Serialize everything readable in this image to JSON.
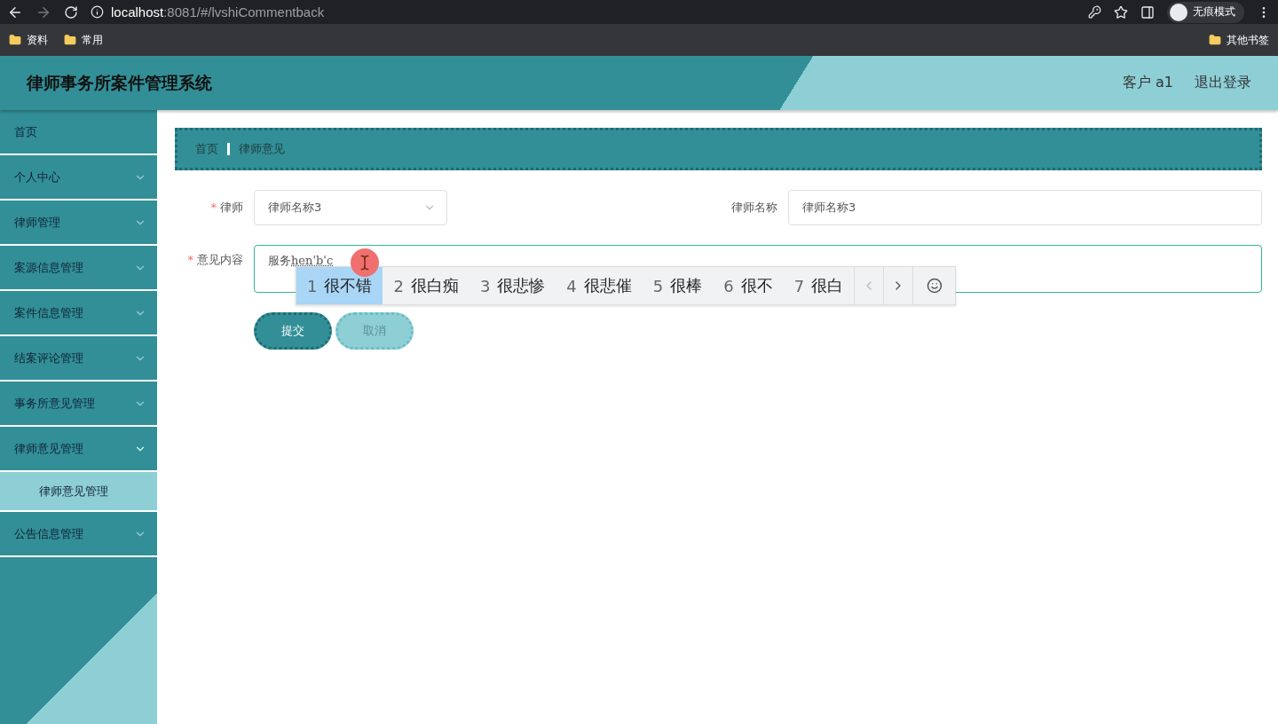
{
  "browser": {
    "url_host": "localhost",
    "url_path": ":8081/#/lvshiCommentback",
    "profile_label": "无痕模式",
    "bookmarks": [
      "资料",
      "常用"
    ],
    "other_bookmarks": "其他书签"
  },
  "header": {
    "title": "律师事务所案件管理系统",
    "user": "客户 a1",
    "logout": "退出登录"
  },
  "sidebar": {
    "items": [
      {
        "label": "首页",
        "kind": "link"
      },
      {
        "label": "个人中心",
        "kind": "menu",
        "expanded": false
      },
      {
        "label": "律师管理",
        "kind": "menu",
        "expanded": false
      },
      {
        "label": "案源信息管理",
        "kind": "menu",
        "expanded": false
      },
      {
        "label": "案件信息管理",
        "kind": "menu",
        "expanded": false
      },
      {
        "label": "结案评论管理",
        "kind": "menu",
        "expanded": false
      },
      {
        "label": "事务所意见管理",
        "kind": "menu",
        "expanded": false
      },
      {
        "label": "律师意见管理",
        "kind": "menu",
        "expanded": true,
        "children": [
          {
            "label": "律师意见管理",
            "selected": true
          }
        ]
      },
      {
        "label": "公告信息管理",
        "kind": "menu",
        "expanded": false
      }
    ]
  },
  "breadcrumb": [
    "首页",
    "律师意见"
  ],
  "form": {
    "lawyer": {
      "required_mark": "*",
      "label": "律师",
      "value": "律师名称3"
    },
    "lawyer_name": {
      "label": "律师名称",
      "value": "律师名称3"
    },
    "content": {
      "required_mark": "*",
      "label": "意见内容",
      "value": "服务",
      "composition": "hen'b'c"
    },
    "buttons": [
      {
        "label": "提交",
        "kind": "primary"
      },
      {
        "label": "取消",
        "kind": "secondary"
      }
    ]
  },
  "ime": {
    "candidates": [
      {
        "index": "1",
        "text": "很不错",
        "selected": true
      },
      {
        "index": "2",
        "text": "很白痴",
        "selected": false
      },
      {
        "index": "3",
        "text": "很悲惨",
        "selected": false
      },
      {
        "index": "4",
        "text": "很悲催",
        "selected": false
      },
      {
        "index": "5",
        "text": "很棒",
        "selected": false
      },
      {
        "index": "6",
        "text": "很不",
        "selected": false
      },
      {
        "index": "7",
        "text": "很白",
        "selected": false
      }
    ]
  }
}
